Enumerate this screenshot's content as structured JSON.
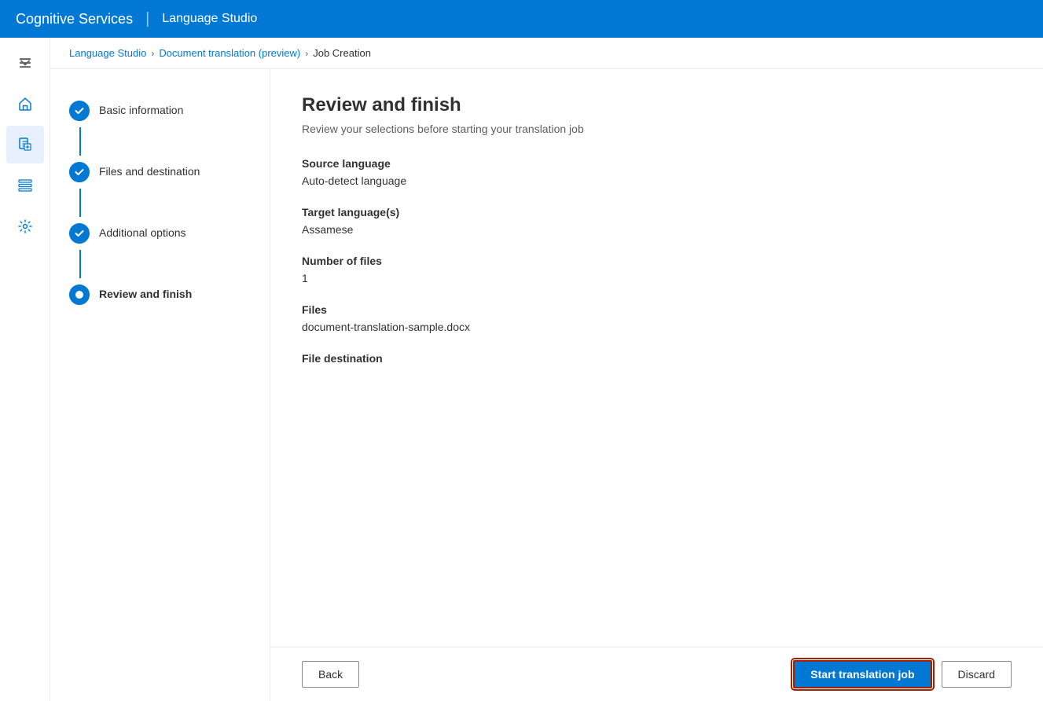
{
  "header": {
    "service_name": "Cognitive Services",
    "divider": "|",
    "studio_name": "Language Studio"
  },
  "breadcrumb": {
    "items": [
      {
        "label": "Language Studio",
        "link": true
      },
      {
        "label": "Document translation (preview)",
        "link": true
      },
      {
        "label": "Job Creation",
        "link": false
      }
    ]
  },
  "wizard": {
    "steps": [
      {
        "id": "basic-info",
        "label": "Basic information",
        "status": "completed"
      },
      {
        "id": "files-destination",
        "label": "Files and destination",
        "status": "completed"
      },
      {
        "id": "additional-options",
        "label": "Additional options",
        "status": "completed"
      },
      {
        "id": "review-finish",
        "label": "Review and finish",
        "status": "active"
      }
    ]
  },
  "review": {
    "title": "Review and finish",
    "subtitle": "Review your selections before starting your translation job",
    "sections": [
      {
        "id": "source-language",
        "label": "Source language",
        "value": "Auto-detect language"
      },
      {
        "id": "target-languages",
        "label": "Target language(s)",
        "value": "Assamese"
      },
      {
        "id": "number-of-files",
        "label": "Number of files",
        "value": "1"
      },
      {
        "id": "files",
        "label": "Files",
        "value": "document-translation-sample.docx"
      },
      {
        "id": "file-destination",
        "label": "File destination",
        "value": ""
      }
    ]
  },
  "actions": {
    "back_label": "Back",
    "start_label": "Start translation job",
    "discard_label": "Discard"
  },
  "nav_icons": [
    {
      "name": "chevron-right",
      "symbol": "»",
      "tooltip": "Expand"
    },
    {
      "name": "home",
      "tooltip": "Home"
    },
    {
      "name": "document-translation",
      "tooltip": "Document Translation",
      "active": true
    },
    {
      "name": "list",
      "tooltip": "List"
    },
    {
      "name": "settings",
      "tooltip": "Settings"
    }
  ]
}
